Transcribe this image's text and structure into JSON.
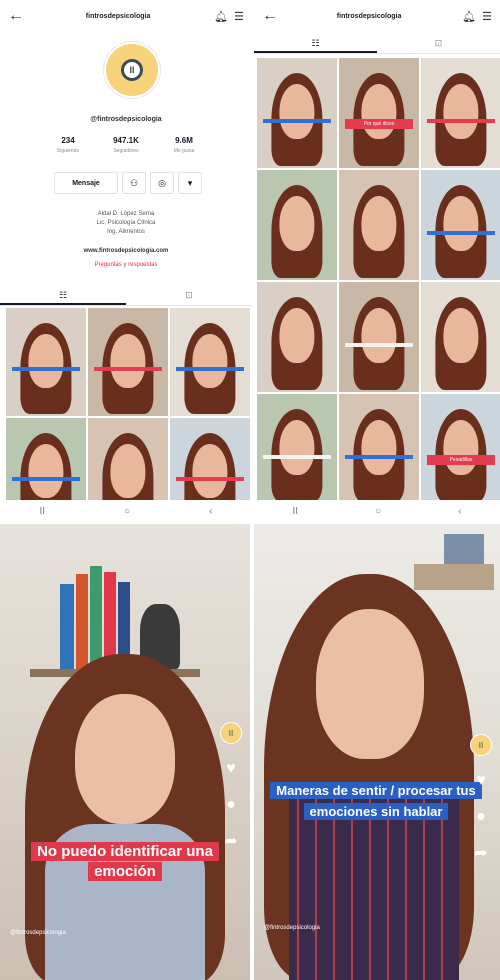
{
  "profile": {
    "title": "fintrosdepsicologia",
    "handle": "@fintrosdepsicologia",
    "stats": [
      {
        "num": "234",
        "lbl": "Siguiendo"
      },
      {
        "num": "947.1K",
        "lbl": "Seguidores"
      },
      {
        "num": "9.6M",
        "lbl": "Me gusta"
      }
    ],
    "message_label": "Mensaje",
    "bio": [
      "Aldai D. López Serna",
      "Lic. Psicología Clínica",
      "Ing. Alimentos"
    ],
    "link": "www.fintrosdepsicologia.com",
    "qa": "Preguntas y respuestas",
    "tabs": [
      "☷",
      "⊡"
    ],
    "grid": [
      {
        "caption": "",
        "views": "",
        "color": "blue"
      },
      {
        "caption": "",
        "views": "",
        "color": "red"
      },
      {
        "caption": "",
        "views": "",
        "color": "blue"
      },
      {
        "caption": "",
        "views": "",
        "color": "blue"
      },
      {
        "caption": "",
        "views": "",
        "color": "none"
      },
      {
        "caption": "",
        "views": "",
        "color": "red"
      }
    ]
  },
  "grid_panel": {
    "title": "fintrosdepsicologia",
    "tabs": [
      "☷",
      "⊡"
    ],
    "cells": [
      {
        "caption": "",
        "color": "blue"
      },
      {
        "caption": "Por qué dices",
        "color": "red"
      },
      {
        "caption": "",
        "color": "red"
      },
      {
        "caption": "",
        "color": "none"
      },
      {
        "caption": "",
        "color": "none"
      },
      {
        "caption": "",
        "color": "blue"
      },
      {
        "caption": "",
        "color": "none"
      },
      {
        "caption": "",
        "color": "white"
      },
      {
        "caption": "",
        "color": "none"
      },
      {
        "caption": "",
        "color": "white"
      },
      {
        "caption": "",
        "color": "blue"
      },
      {
        "caption": "Pesadillas",
        "color": "red"
      }
    ]
  },
  "nav": [
    "II",
    "○",
    "‹"
  ],
  "video1": {
    "caption": "No puedo identificar una emoción",
    "user": "@fintrosdepsicologia",
    "desc": "",
    "music": "",
    "icons": [
      "heart-icon",
      "comment-icon",
      "share-icon"
    ]
  },
  "video2": {
    "caption": "Maneras de sentir / procesar tus emociones sin hablar",
    "user": "@fintrosdepsicologia",
    "desc": "",
    "music": "",
    "icons": [
      "heart-icon",
      "comment-icon",
      "share-icon"
    ]
  },
  "colors": {
    "accent_red": "#e0394c",
    "accent_blue": "#2a5fc4",
    "logo_yellow": "#f6d27a"
  }
}
